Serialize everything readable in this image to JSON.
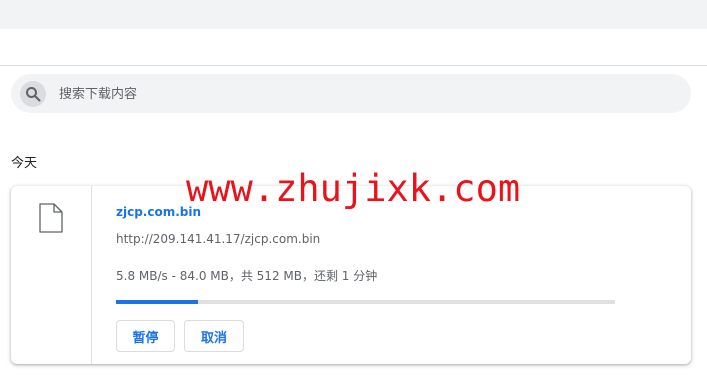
{
  "search": {
    "placeholder": "搜索下载内容"
  },
  "section": {
    "label": "今天"
  },
  "download": {
    "file_name": "zjcp.com.bin",
    "url": "http://209.141.41.17/zjcp.com.bin",
    "status": "5.8 MB/s - 84.0 MB，共 512 MB，还剩 1 分钟",
    "progress_fraction": 0.164,
    "pause_label": "暂停",
    "cancel_label": "取消"
  },
  "watermark": {
    "text": "www.zhujixk.com"
  },
  "colors": {
    "accent": "#1a73e8",
    "watermark": "#e8141c"
  }
}
